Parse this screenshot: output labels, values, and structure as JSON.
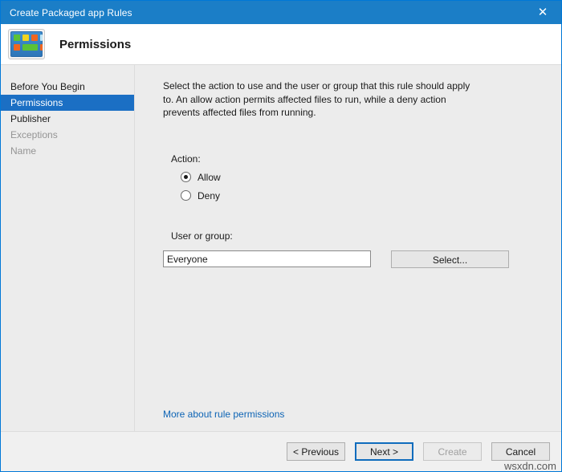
{
  "window": {
    "title": "Create Packaged app Rules",
    "close_icon": "close-icon",
    "titlebar_color": "#1b7ec7"
  },
  "header": {
    "icon": "packaged-app-icon",
    "title": "Permissions"
  },
  "sidebar": {
    "items": [
      {
        "label": "Before You Begin",
        "state": "visited"
      },
      {
        "label": "Permissions",
        "state": "selected"
      },
      {
        "label": "Publisher",
        "state": "visited"
      },
      {
        "label": "Exceptions",
        "state": "disabled"
      },
      {
        "label": "Name",
        "state": "disabled"
      }
    ],
    "selected_color": "#1b6fc4"
  },
  "main": {
    "description": "Select the action to use and the user or group that this rule should apply to. An allow action permits affected files to run, while a deny action prevents affected files from running.",
    "action": {
      "label": "Action:",
      "options": [
        {
          "label": "Allow",
          "checked": true
        },
        {
          "label": "Deny",
          "checked": false
        }
      ]
    },
    "user_or_group": {
      "label": "User or group:",
      "value": "Everyone",
      "placeholder": "",
      "select_button": "Select..."
    },
    "help_link": "More about rule permissions",
    "link_color": "#0d64b5"
  },
  "footer": {
    "buttons": [
      {
        "label": "< Previous",
        "state": "enabled"
      },
      {
        "label": "Next >",
        "state": "focused"
      },
      {
        "label": "Create",
        "state": "disabled"
      },
      {
        "label": "Cancel",
        "state": "enabled"
      }
    ]
  },
  "watermark": "wsxdn.com"
}
